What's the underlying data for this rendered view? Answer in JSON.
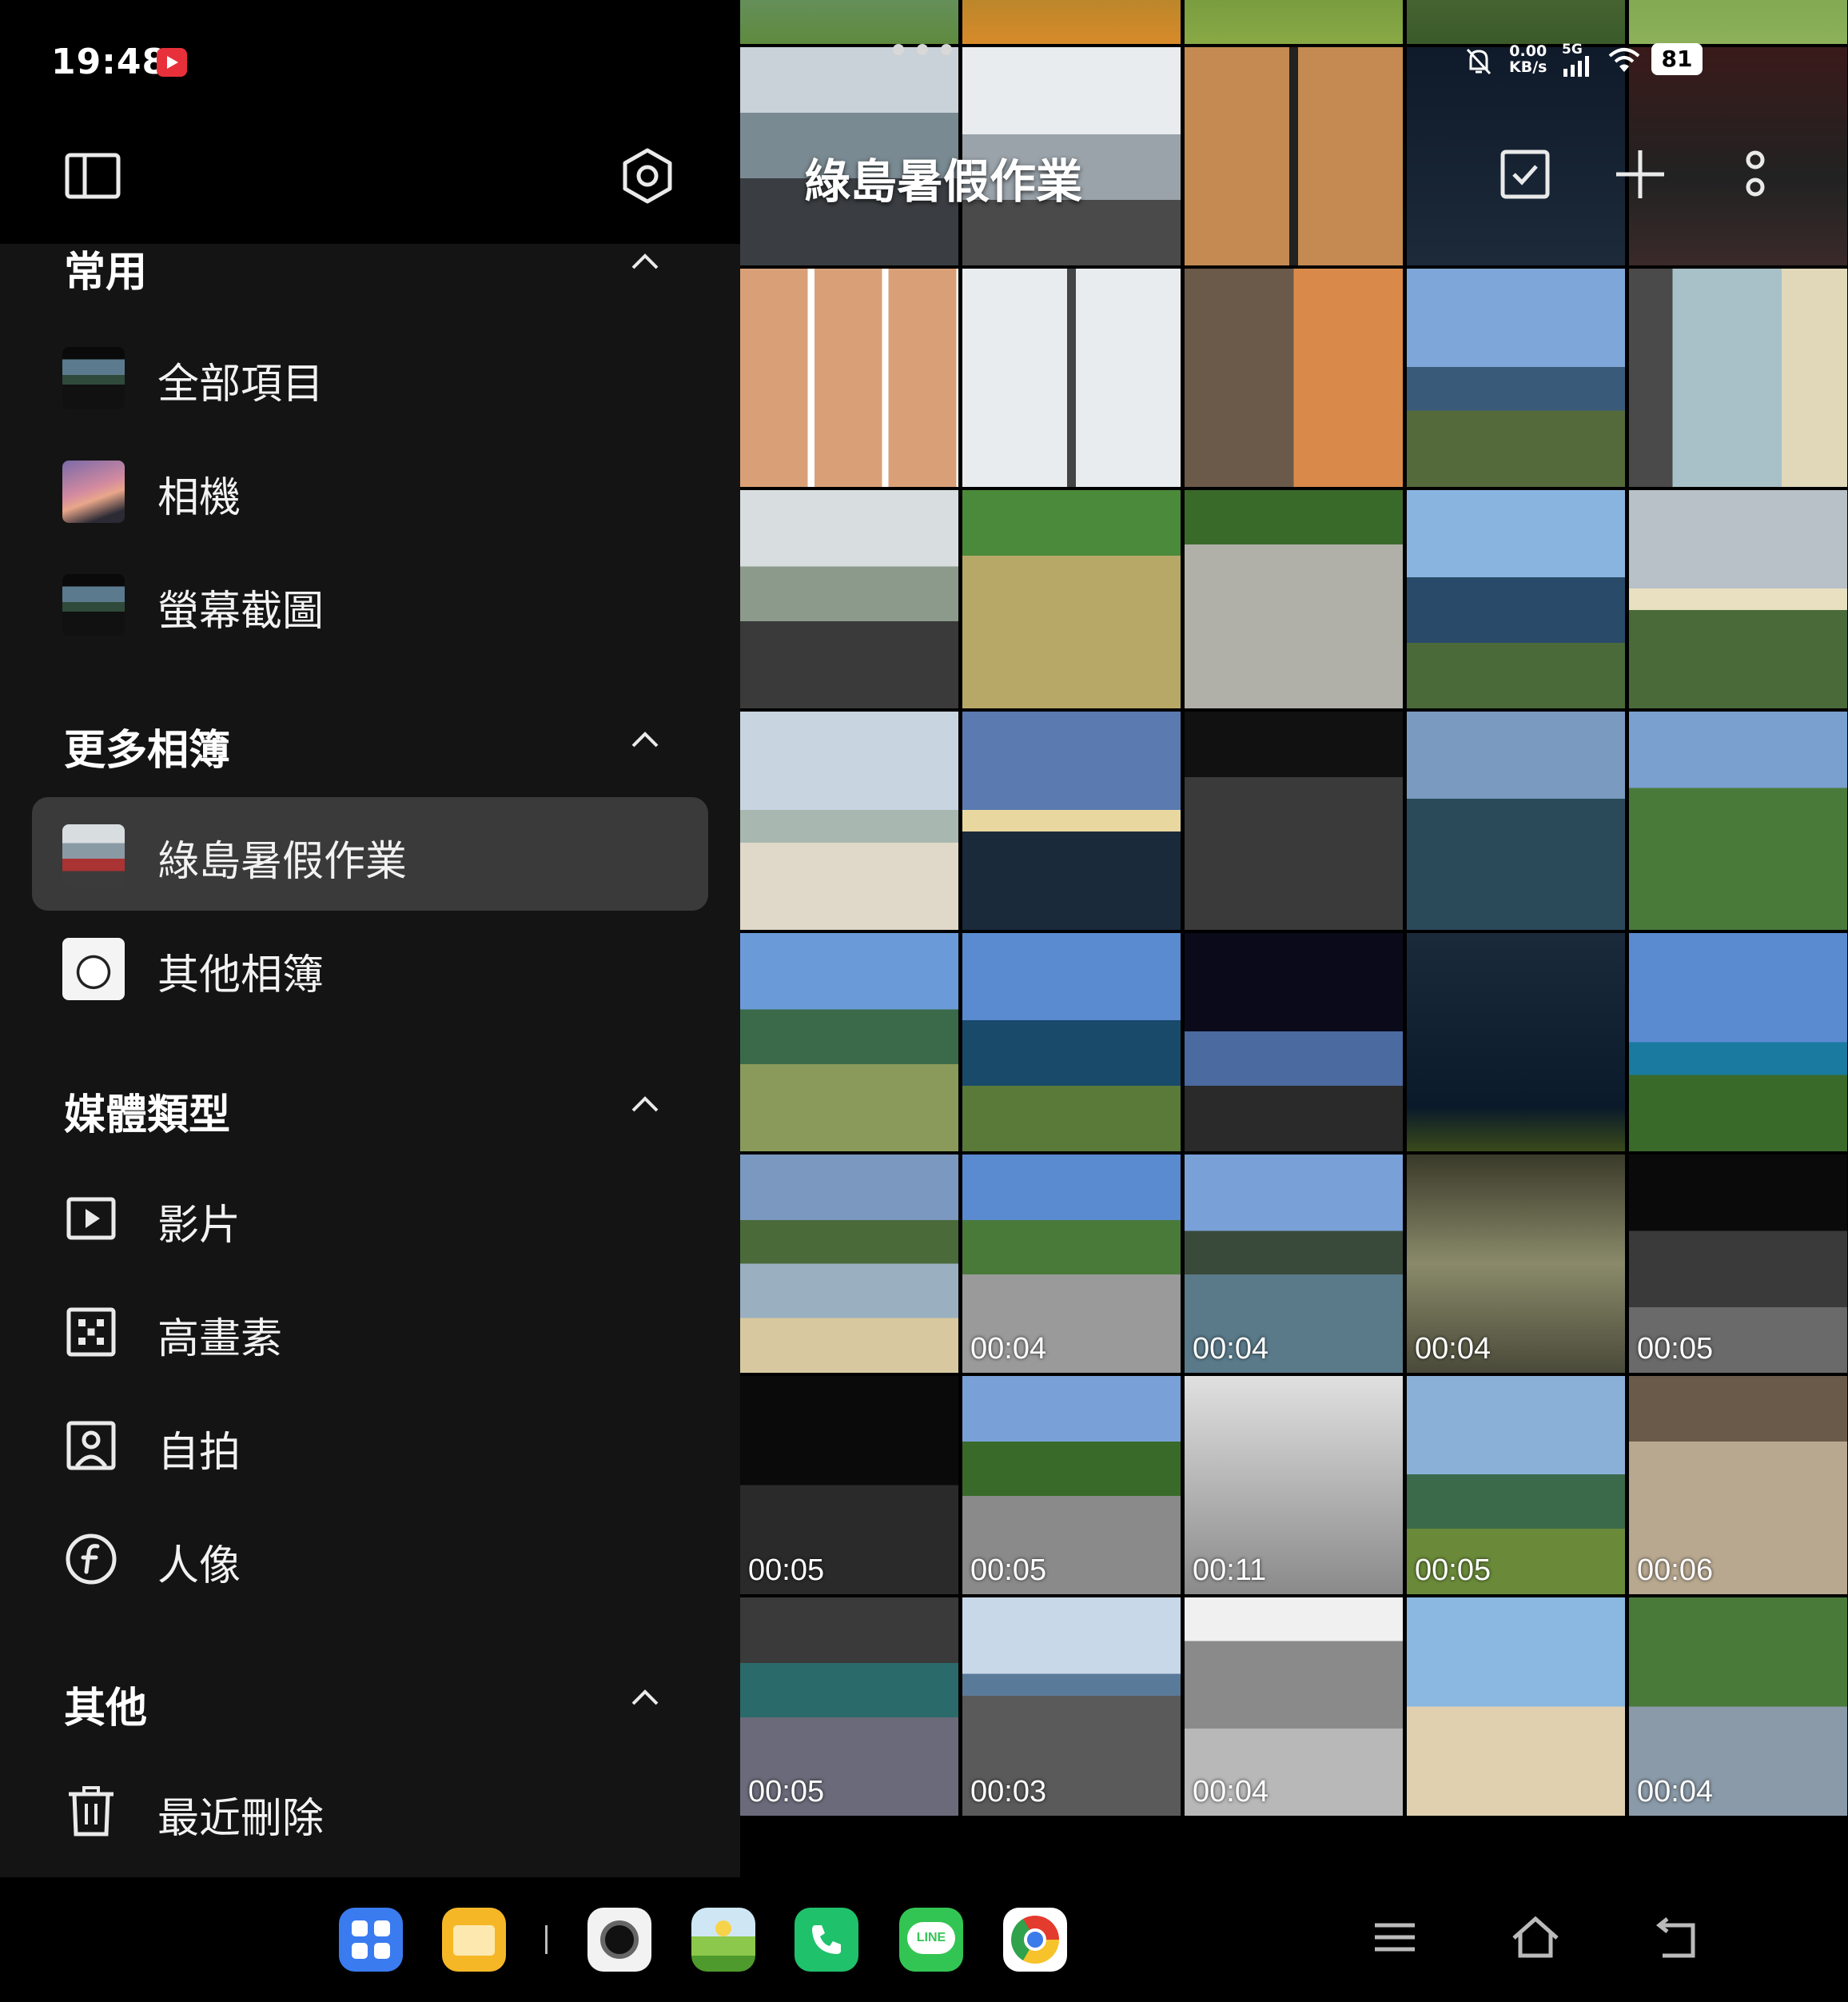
{
  "status_bar": {
    "time": "19:48",
    "net_speed_value": "0.00",
    "net_speed_unit": "KB/s",
    "network": "5G",
    "battery": "81"
  },
  "sidebar": {
    "toolbar": {
      "left_icon": "sidebar-toggle-icon",
      "right_icon": "settings-hex-icon"
    },
    "sections": [
      {
        "title": "常用",
        "items": [
          "全部項目",
          "相機",
          "螢幕截圖"
        ]
      },
      {
        "title": "更多相簿",
        "items": [
          "綠島暑假作業",
          "其他相簿"
        ],
        "active": "綠島暑假作業"
      },
      {
        "title": "媒體類型",
        "items": [
          "影片",
          "高畫素",
          "自拍",
          "人像"
        ]
      },
      {
        "title": "其他",
        "items": [
          "最近刪除"
        ]
      }
    ]
  },
  "album": {
    "title": "綠島暑假作業",
    "actions": [
      "select-icon",
      "add-icon",
      "more-icon"
    ]
  },
  "grid": {
    "rows": [
      {
        "durations": [
          "",
          "",
          "",
          "",
          ""
        ]
      },
      {
        "durations": [
          "",
          "",
          "",
          "",
          ""
        ]
      },
      {
        "durations": [
          "",
          "",
          "",
          "",
          ""
        ]
      },
      {
        "durations": [
          "",
          "",
          "",
          "",
          ""
        ]
      },
      {
        "durations": [
          "",
          "",
          "",
          "",
          ""
        ]
      },
      {
        "durations": [
          "",
          "00:04",
          "00:04",
          "00:04",
          "00:05"
        ]
      },
      {
        "durations": [
          "00:05",
          "00:05",
          "00:11",
          "00:05",
          "00:06"
        ]
      },
      {
        "durations": [
          "00:05",
          "00:03",
          "00:04",
          "",
          "00:04"
        ]
      }
    ]
  },
  "dock": {
    "apps": [
      "app-drawer-icon",
      "file-manager-icon",
      "camera-app-icon",
      "gallery-app-icon",
      "phone-app-icon",
      "line-app-icon",
      "chrome-app-icon"
    ],
    "line_label": "LINE",
    "nav": [
      "recents-icon",
      "home-icon",
      "back-icon"
    ]
  },
  "colors": {
    "sidebar_bg": "#141414",
    "active_item_bg": "#3a3a3a",
    "record_badge": "#e8303a"
  }
}
